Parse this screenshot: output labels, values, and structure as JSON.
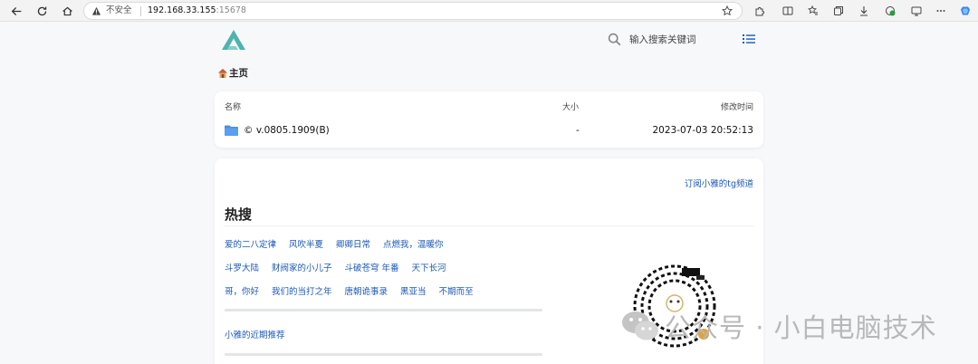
{
  "browser": {
    "security_label": "不安全",
    "host": "192.168.33.155",
    "port": ":15678"
  },
  "header": {
    "search_placeholder": "输入搜索关键词"
  },
  "breadcrumb": {
    "label": "主页"
  },
  "file_list": {
    "columns": {
      "name": "名称",
      "size": "大小",
      "modified": "修改时间"
    },
    "rows": [
      {
        "name": "© v.0805.1909(B)",
        "size": "-",
        "modified": "2023-07-03 20:52:13"
      }
    ]
  },
  "main": {
    "tg_link": "订阅小雅的tg频道",
    "hot_title": "热搜",
    "hot_rows": [
      [
        "爱的二八定律",
        "风吹半夏",
        "卿卿日常",
        "点燃我，温暖你"
      ],
      [
        "斗罗大陆",
        "财阀家的小儿子",
        "斗破苍穹 年番",
        "天下长河"
      ],
      [
        "哥，你好",
        "我们的当打之年",
        "唐朝诡事录",
        "黑亚当",
        "不期而至"
      ]
    ],
    "recent_label": "小雅的近期推荐"
  },
  "overlay": {
    "watermark_text": "公众号 · 小白电脑技术"
  },
  "colors": {
    "link": "#1a59b8",
    "logo": "#4fb3b0",
    "folder": "#4a90e2"
  }
}
